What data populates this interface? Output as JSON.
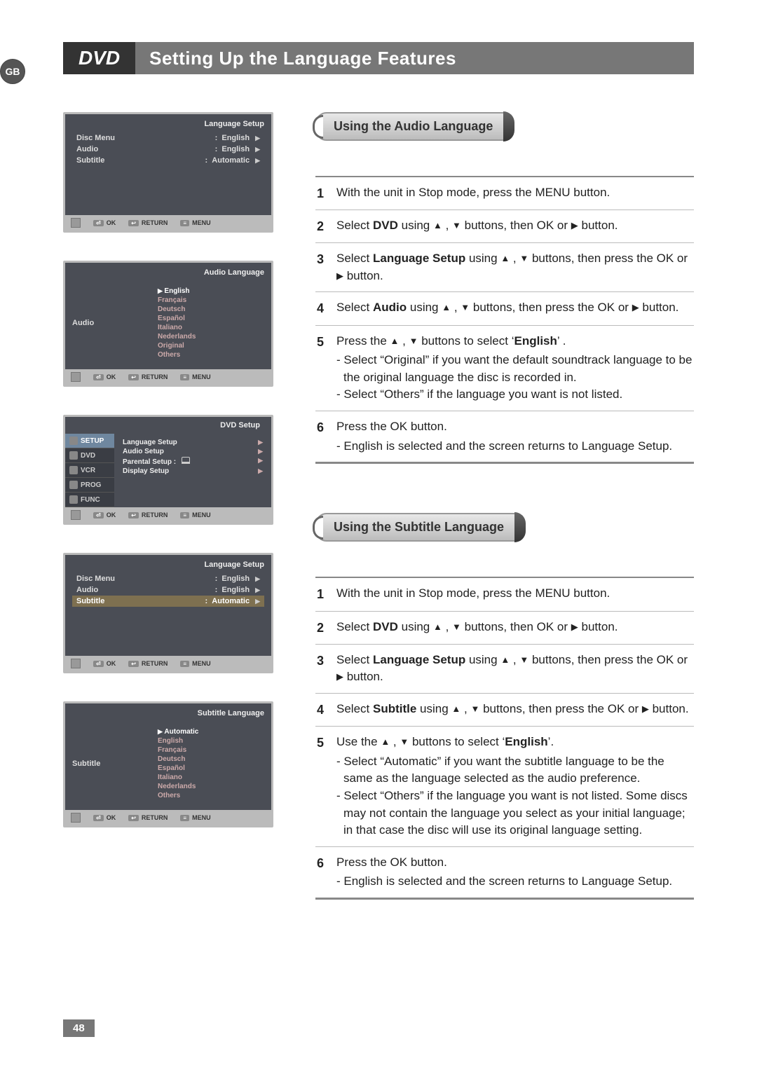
{
  "region_badge": "GB",
  "title_chip": "DVD",
  "title_text": "Setting Up the Language Features",
  "page_number": "48",
  "osd_footer": {
    "ok": "OK",
    "return": "RETURN",
    "menu": "MENU"
  },
  "osd1": {
    "title": "Language Setup",
    "rows": [
      {
        "label": "Disc Menu",
        "value": "English"
      },
      {
        "label": "Audio",
        "value": "English"
      },
      {
        "label": "Subtitle",
        "value": "Automatic"
      }
    ]
  },
  "osd2": {
    "title": "Audio Language",
    "label": "Audio",
    "items": [
      "English",
      "Français",
      "Deutsch",
      "Español",
      "Italiano",
      "Nederlands",
      "Original",
      "Others"
    ],
    "selected_index": 0
  },
  "osd3": {
    "title": "DVD Setup",
    "tabs": [
      "SETUP",
      "DVD",
      "VCR",
      "PROG",
      "FUNC"
    ],
    "selected_tab_index": 0,
    "rows": [
      "Language Setup",
      "Audio Setup",
      "Parental Setup",
      "Display Setup"
    ],
    "parental_index": 2
  },
  "osd4": {
    "title": "Language Setup",
    "rows": [
      {
        "label": "Disc Menu",
        "value": "English"
      },
      {
        "label": "Audio",
        "value": "English"
      },
      {
        "label": "Subtitle",
        "value": "Automatic"
      }
    ],
    "highlight_index": 2
  },
  "osd5": {
    "title": "Subtitle Language",
    "label": "Subtitle",
    "items": [
      "Automatic",
      "English",
      "Français",
      "Deutsch",
      "Español",
      "Italiano",
      "Nederlands",
      "Others"
    ],
    "selected_index": 0
  },
  "section_a": {
    "heading": "Using the Audio Language",
    "steps": [
      {
        "n": "1",
        "text": "With the unit in Stop mode, press the MENU button."
      },
      {
        "n": "2",
        "pre": "Select ",
        "bold": "DVD",
        "post": " using ▲ , ▼ buttons, then OK or ▶ button."
      },
      {
        "n": "3",
        "pre": "Select ",
        "bold": "Language Setup",
        "post": " using ▲ , ▼ buttons, then press the OK or ▶ button."
      },
      {
        "n": "4",
        "pre": "Select ",
        "bold": "Audio",
        "post": " using ▲ , ▼ buttons, then press the OK or ▶ button."
      },
      {
        "n": "5",
        "lead_pre": "Press the ▲ , ▼ buttons to select ‘",
        "lead_bold": "English",
        "lead_post": "’ .",
        "bullets": [
          "- Select “Original” if you want the default soundtrack language to be the original language the disc is recorded in.",
          "- Select “Others” if the language you want is not listed."
        ]
      },
      {
        "n": "6",
        "lead": "Press the OK button.",
        "bullets": [
          "- English is selected and the screen returns to Language Setup."
        ]
      }
    ]
  },
  "section_b": {
    "heading": "Using the Subtitle Language",
    "steps": [
      {
        "n": "1",
        "text": "With the unit in Stop mode, press the MENU button."
      },
      {
        "n": "2",
        "pre": "Select ",
        "bold": "DVD",
        "post": " using ▲ , ▼ buttons, then OK or ▶ button."
      },
      {
        "n": "3",
        "pre": "Select ",
        "bold": "Language Setup",
        "post": " using ▲ , ▼ buttons, then press the OK or ▶ button."
      },
      {
        "n": "4",
        "pre": "Select ",
        "bold": "Subtitle",
        "post": " using ▲ , ▼ buttons, then press the OK or ▶ button."
      },
      {
        "n": "5",
        "lead_pre": "Use the ▲ , ▼ buttons to select ‘",
        "lead_bold": "English",
        "lead_post": "’.",
        "bullets": [
          "- Select “Automatic” if you want the subtitle language to be the same as the language selected as the audio preference.",
          "- Select “Others” if the language you want is not listed. Some discs may not contain the language you select as your initial language; in that case the disc will use its original language setting."
        ]
      },
      {
        "n": "6",
        "lead": "Press the OK button.",
        "bullets": [
          "- English is selected and the screen returns to Language Setup."
        ]
      }
    ]
  }
}
